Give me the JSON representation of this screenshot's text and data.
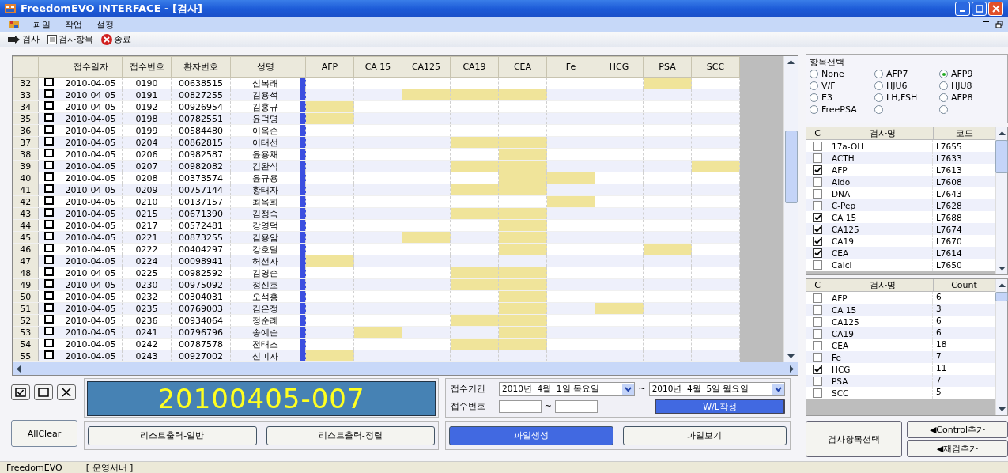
{
  "window": {
    "title": "FreedomEVO INTERFACE - [검사]"
  },
  "menu": [
    "파일",
    "작업",
    "설정"
  ],
  "toolbar": [
    "검사",
    "검사항목",
    "종료"
  ],
  "table": {
    "columns": [
      "접수일자",
      "접수번호",
      "환자번호",
      "성명"
    ],
    "tests": [
      "AFP",
      "CA 15",
      "CA125",
      "CA19",
      "CEA",
      "Fe",
      "HCG",
      "PSA",
      "SCC"
    ],
    "rows": [
      {
        "no": "32",
        "checked": false,
        "date": "2010-04-05",
        "receipt": "0190",
        "patient": "00638515",
        "name": "심복래",
        "marks": [
          false,
          false,
          false,
          false,
          false,
          false,
          false,
          true,
          false
        ]
      },
      {
        "no": "33",
        "checked": false,
        "date": "2010-04-05",
        "receipt": "0191",
        "patient": "00827255",
        "name": "김용석",
        "marks": [
          false,
          false,
          true,
          true,
          true,
          false,
          false,
          false,
          false
        ]
      },
      {
        "no": "34",
        "checked": false,
        "date": "2010-04-05",
        "receipt": "0192",
        "patient": "00926954",
        "name": "김홍규",
        "marks": [
          true,
          false,
          false,
          false,
          false,
          false,
          false,
          false,
          false
        ]
      },
      {
        "no": "35",
        "checked": false,
        "date": "2010-04-05",
        "receipt": "0198",
        "patient": "00782551",
        "name": "윤덕명",
        "marks": [
          true,
          false,
          false,
          false,
          false,
          false,
          false,
          false,
          false
        ]
      },
      {
        "no": "36",
        "checked": false,
        "date": "2010-04-05",
        "receipt": "0199",
        "patient": "00584480",
        "name": "이옥순",
        "marks": [
          false,
          false,
          false,
          false,
          false,
          false,
          false,
          false,
          false
        ]
      },
      {
        "no": "37",
        "checked": false,
        "date": "2010-04-05",
        "receipt": "0204",
        "patient": "00862815",
        "name": "이태선",
        "marks": [
          false,
          false,
          false,
          true,
          true,
          false,
          false,
          false,
          false
        ]
      },
      {
        "no": "38",
        "checked": false,
        "date": "2010-04-05",
        "receipt": "0206",
        "patient": "00982587",
        "name": "윤용채",
        "marks": [
          false,
          false,
          false,
          false,
          true,
          false,
          false,
          false,
          false
        ]
      },
      {
        "no": "39",
        "checked": false,
        "date": "2010-04-05",
        "receipt": "0207",
        "patient": "00982082",
        "name": "김완식",
        "marks": [
          false,
          false,
          false,
          true,
          true,
          false,
          false,
          false,
          true
        ]
      },
      {
        "no": "40",
        "checked": false,
        "date": "2010-04-05",
        "receipt": "0208",
        "patient": "00373574",
        "name": "윤규용",
        "marks": [
          false,
          false,
          false,
          false,
          true,
          true,
          false,
          false,
          false
        ]
      },
      {
        "no": "41",
        "checked": false,
        "date": "2010-04-05",
        "receipt": "0209",
        "patient": "00757144",
        "name": "황태자",
        "marks": [
          false,
          false,
          false,
          true,
          true,
          false,
          false,
          false,
          false
        ]
      },
      {
        "no": "42",
        "checked": false,
        "date": "2010-04-05",
        "receipt": "0210",
        "patient": "00137157",
        "name": "최옥희",
        "marks": [
          false,
          false,
          false,
          false,
          false,
          true,
          false,
          false,
          false
        ]
      },
      {
        "no": "43",
        "checked": false,
        "date": "2010-04-05",
        "receipt": "0215",
        "patient": "00671390",
        "name": "김정숙",
        "marks": [
          false,
          false,
          false,
          true,
          true,
          false,
          false,
          false,
          false
        ]
      },
      {
        "no": "44",
        "checked": false,
        "date": "2010-04-05",
        "receipt": "0217",
        "patient": "00572481",
        "name": "강영덕",
        "marks": [
          false,
          false,
          false,
          false,
          true,
          false,
          false,
          false,
          false
        ]
      },
      {
        "no": "45",
        "checked": false,
        "date": "2010-04-05",
        "receipt": "0221",
        "patient": "00873255",
        "name": "김용암",
        "marks": [
          false,
          false,
          true,
          false,
          true,
          false,
          false,
          false,
          false
        ]
      },
      {
        "no": "46",
        "checked": false,
        "date": "2010-04-05",
        "receipt": "0222",
        "patient": "00404297",
        "name": "강호달",
        "marks": [
          false,
          false,
          false,
          false,
          true,
          false,
          false,
          true,
          false
        ]
      },
      {
        "no": "47",
        "checked": false,
        "date": "2010-04-05",
        "receipt": "0224",
        "patient": "00098941",
        "name": "허선자",
        "marks": [
          true,
          false,
          false,
          false,
          false,
          false,
          false,
          false,
          false
        ]
      },
      {
        "no": "48",
        "checked": false,
        "date": "2010-04-05",
        "receipt": "0225",
        "patient": "00982592",
        "name": "김영순",
        "marks": [
          false,
          false,
          false,
          true,
          true,
          false,
          false,
          false,
          false
        ]
      },
      {
        "no": "49",
        "checked": false,
        "date": "2010-04-05",
        "receipt": "0230",
        "patient": "00975092",
        "name": "정신호",
        "marks": [
          false,
          false,
          false,
          true,
          true,
          false,
          false,
          false,
          false
        ]
      },
      {
        "no": "50",
        "checked": false,
        "date": "2010-04-05",
        "receipt": "0232",
        "patient": "00304031",
        "name": "오석홍",
        "marks": [
          false,
          false,
          false,
          false,
          true,
          false,
          false,
          false,
          false
        ]
      },
      {
        "no": "51",
        "checked": false,
        "date": "2010-04-05",
        "receipt": "0235",
        "patient": "00769003",
        "name": "김은정",
        "marks": [
          false,
          false,
          false,
          false,
          true,
          false,
          true,
          false,
          false
        ]
      },
      {
        "no": "52",
        "checked": false,
        "date": "2010-04-05",
        "receipt": "0236",
        "patient": "00934064",
        "name": "정순례",
        "marks": [
          false,
          false,
          false,
          true,
          true,
          false,
          false,
          false,
          false
        ]
      },
      {
        "no": "53",
        "checked": false,
        "date": "2010-04-05",
        "receipt": "0241",
        "patient": "00796796",
        "name": "송예순",
        "marks": [
          false,
          true,
          false,
          false,
          true,
          false,
          false,
          false,
          false
        ]
      },
      {
        "no": "54",
        "checked": false,
        "date": "2010-04-05",
        "receipt": "0242",
        "patient": "00787578",
        "name": "전태조",
        "marks": [
          false,
          false,
          false,
          true,
          true,
          false,
          false,
          false,
          false
        ]
      },
      {
        "no": "55",
        "checked": false,
        "date": "2010-04-05",
        "receipt": "0243",
        "patient": "00927002",
        "name": "신미자",
        "marks": [
          true,
          false,
          false,
          false,
          false,
          false,
          false,
          false,
          false
        ]
      }
    ]
  },
  "display": "20100405-007",
  "all_clear": "AllClear",
  "list_buttons": [
    "리스트출력-일반",
    "리스트출력-정렬"
  ],
  "period": {
    "label": "접수기간",
    "from": "2010년  4월  1일 목요일",
    "sep": "~",
    "to": "2010년  4월  5일 월요일"
  },
  "receipt_range": {
    "label": "접수번호",
    "sep": "~"
  },
  "wl_button": "W/L작성",
  "file_buttons": [
    {
      "label": "파일생성",
      "selected": true
    },
    {
      "label": "파일보기",
      "selected": false
    }
  ],
  "item_select": {
    "title": "항목선택",
    "options": [
      {
        "label": "None",
        "selected": false
      },
      {
        "label": "AFP7",
        "selected": false
      },
      {
        "label": "AFP9",
        "selected": true
      },
      {
        "label": "V/F",
        "selected": false
      },
      {
        "label": "HJU6",
        "selected": false
      },
      {
        "label": "HJU8",
        "selected": false
      },
      {
        "label": "E3",
        "selected": false
      },
      {
        "label": "LH,FSH",
        "selected": false
      },
      {
        "label": "AFP8",
        "selected": false
      },
      {
        "label": "FreePSA",
        "selected": false
      },
      {
        "selected": false
      },
      {
        "selected": false
      }
    ]
  },
  "test_list": {
    "columns": [
      "C",
      "검사명",
      "코드"
    ],
    "rows": [
      {
        "checked": false,
        "name": "17a-OH",
        "code": "L7655"
      },
      {
        "checked": false,
        "name": "ACTH",
        "code": "L7633"
      },
      {
        "checked": true,
        "name": "AFP",
        "code": "L7613"
      },
      {
        "checked": false,
        "name": "Aldo",
        "code": "L7608"
      },
      {
        "checked": false,
        "name": "DNA",
        "code": "L7643"
      },
      {
        "checked": false,
        "name": "C-Pep",
        "code": "L7628"
      },
      {
        "checked": true,
        "name": "CA 15",
        "code": "L7688"
      },
      {
        "checked": true,
        "name": "CA125",
        "code": "L7674"
      },
      {
        "checked": true,
        "name": "CA19",
        "code": "L7670"
      },
      {
        "checked": true,
        "name": "CEA",
        "code": "L7614"
      },
      {
        "checked": false,
        "name": "Calci",
        "code": "L7650"
      }
    ]
  },
  "count_list": {
    "columns": [
      "C",
      "검사명",
      "Count"
    ],
    "rows": [
      {
        "checked": false,
        "name": "AFP",
        "count": "6"
      },
      {
        "checked": false,
        "name": "CA 15",
        "count": "3"
      },
      {
        "checked": false,
        "name": "CA125",
        "count": "6"
      },
      {
        "checked": false,
        "name": "CA19",
        "count": "6"
      },
      {
        "checked": false,
        "name": "CEA",
        "count": "18"
      },
      {
        "checked": false,
        "name": "Fe",
        "count": "7"
      },
      {
        "checked": true,
        "name": "HCG",
        "count": "11"
      },
      {
        "checked": false,
        "name": "PSA",
        "count": "7"
      },
      {
        "checked": false,
        "name": "SCC",
        "count": "5"
      }
    ]
  },
  "side_buttons": [
    "검사항목선택",
    "◀Control추가",
    "◀재검추가"
  ],
  "status_bar": [
    "FreedomEVO",
    "[ 운영서버 ]"
  ]
}
